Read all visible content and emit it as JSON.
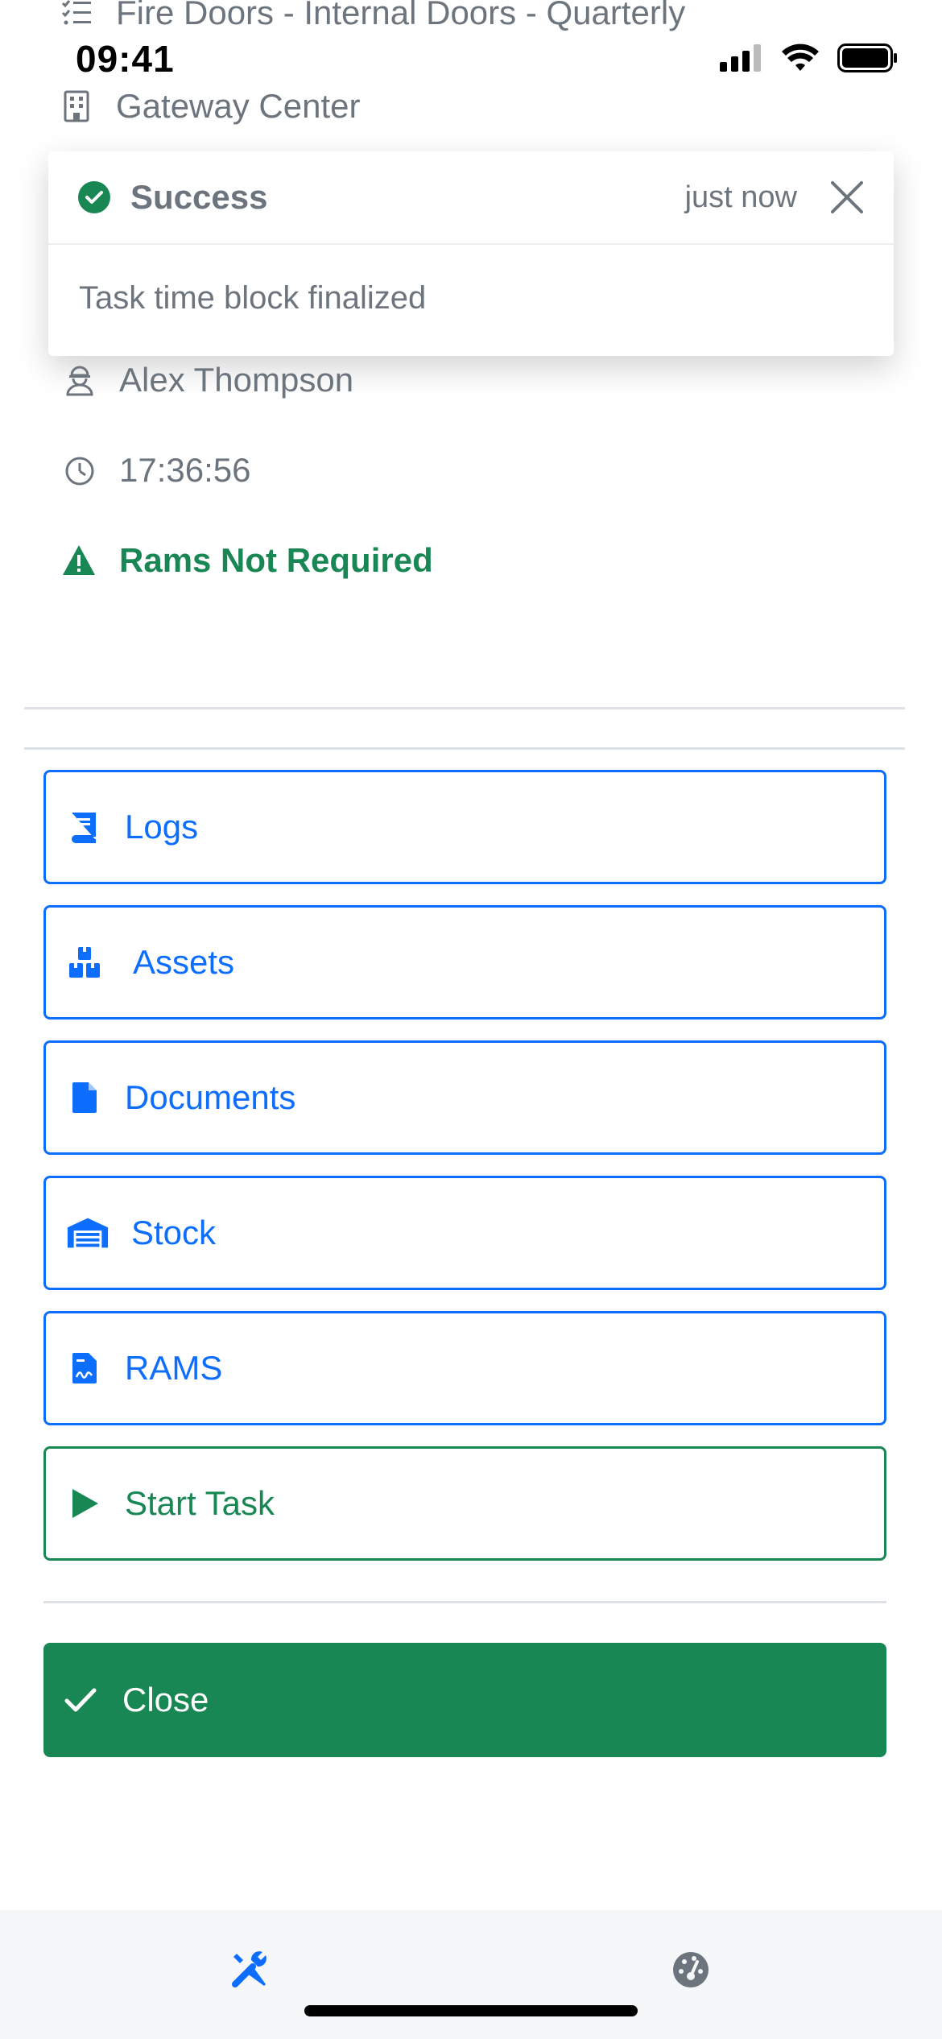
{
  "header": {
    "task_title": "Fire Doors - Internal Doors - Quarterly",
    "site": "Gateway Center"
  },
  "status_bar": {
    "time": "09:41"
  },
  "toast": {
    "title": "Success",
    "time": "just now",
    "message": "Task time block finalized"
  },
  "details": {
    "engineer": "Alex Thompson",
    "duration": "17:36:56",
    "rams_status": "Rams Not Required"
  },
  "actions": [
    {
      "label": "Logs",
      "icon": "book-icon"
    },
    {
      "label": "Assets",
      "icon": "boxes-icon"
    },
    {
      "label": "Documents",
      "icon": "file-icon"
    },
    {
      "label": "Stock",
      "icon": "warehouse-icon"
    },
    {
      "label": "RAMS",
      "icon": "file-signature-icon"
    },
    {
      "label": "Start Task",
      "icon": "play-icon"
    }
  ],
  "close_label": "Close",
  "tabbar": {
    "tabs": [
      {
        "icon": "tools-icon",
        "active": true
      },
      {
        "icon": "dashboard-gauge-icon",
        "active": false
      }
    ]
  },
  "colors": {
    "primary": "#0d6efd",
    "success": "#198754",
    "muted": "#6c757d",
    "tabbar_bg": "#f6f7f9"
  }
}
